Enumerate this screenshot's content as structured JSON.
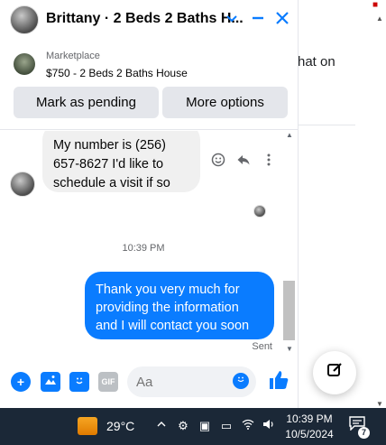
{
  "header": {
    "title": "Brittany · 2 Beds 2 Baths H..."
  },
  "listing": {
    "label": "Marketplace",
    "title": "$750 - 2 Beds 2 Baths House",
    "buttons": [
      "Mark as pending",
      "More options"
    ]
  },
  "messages": {
    "incoming": "My number is (256) 657-8627 I'd like to schedule a visit if so",
    "timestamp": "10:39 PM",
    "outgoing": "Thank you very much for providing the information and I will contact you soon",
    "status": "Sent"
  },
  "composer": {
    "placeholder": "Aa",
    "gif_label": "GIF"
  },
  "background": {
    "partial_text": "hat on"
  },
  "taskbar": {
    "temperature": "29°C",
    "time": "10:39 PM",
    "date": "10/5/2024",
    "notification_count": "7"
  },
  "colors": {
    "accent": "#0a7cff",
    "bubble_in": "#f0f0f0",
    "taskbar": "#1b2837"
  }
}
